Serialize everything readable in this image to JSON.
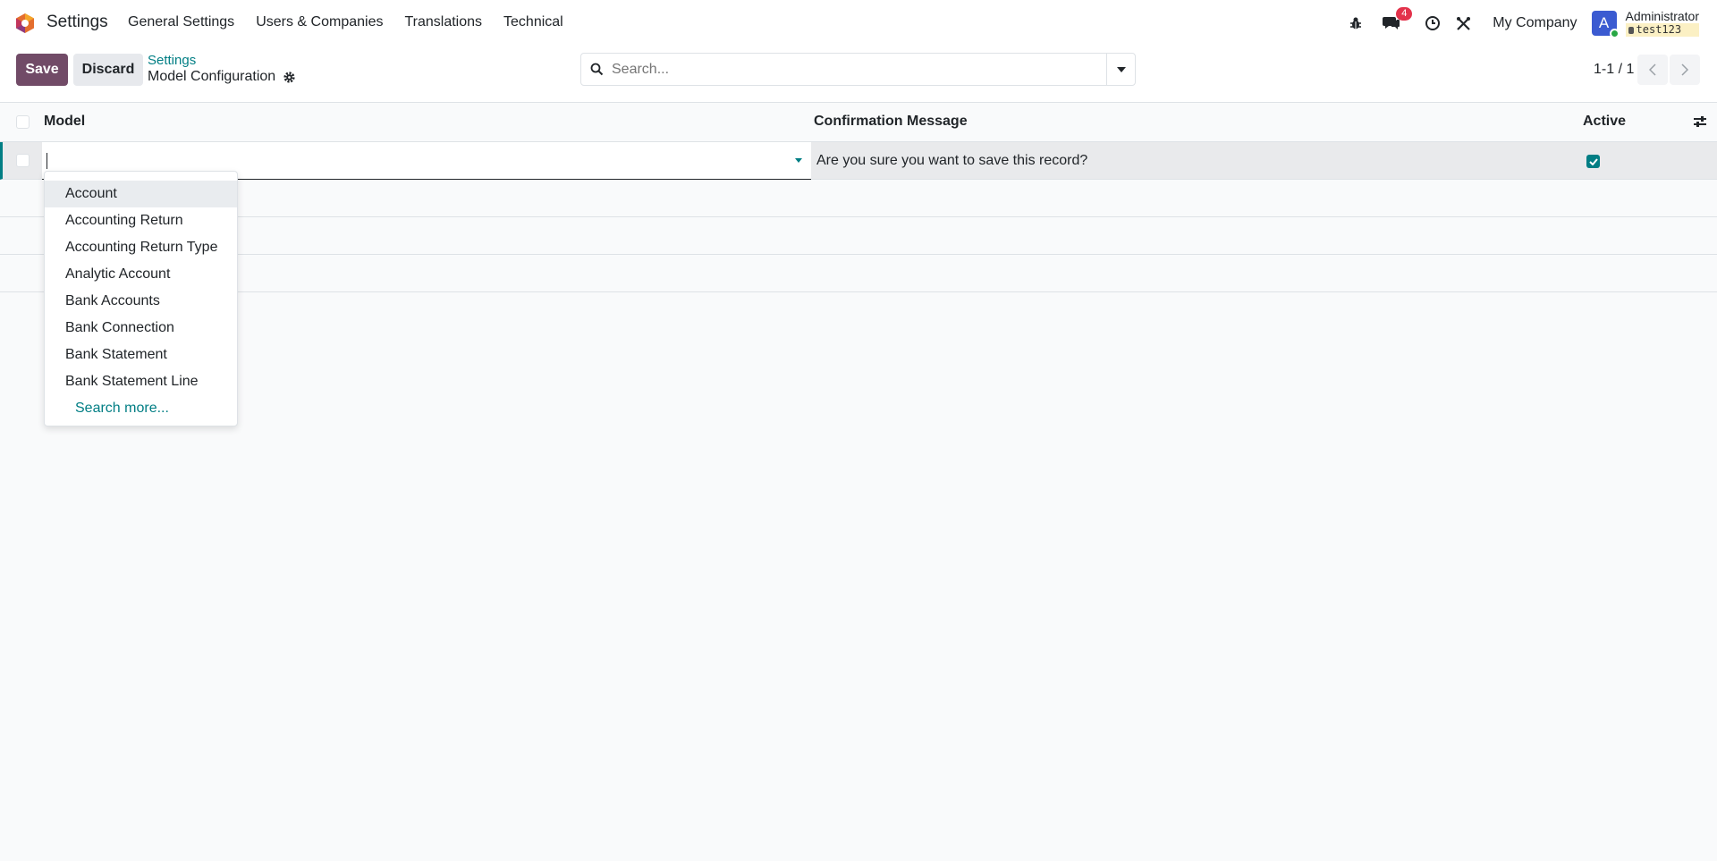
{
  "navbar": {
    "app_title": "Settings",
    "menu": [
      "General Settings",
      "Users & Companies",
      "Translations",
      "Technical"
    ],
    "messages_badge": "4",
    "company": "My Company",
    "avatar_letter": "A",
    "user_name": "Administrator",
    "db_name": "test123"
  },
  "control_panel": {
    "save_label": "Save",
    "discard_label": "Discard",
    "breadcrumb_parent": "Settings",
    "breadcrumb_current": "Model Configuration",
    "search_placeholder": "Search...",
    "pager": "1-1 / 1"
  },
  "list": {
    "columns": {
      "model": "Model",
      "confirmation_message": "Confirmation Message",
      "active": "Active"
    },
    "rows": [
      {
        "model": "",
        "confirmation_message": "Are you sure you want to save this record?",
        "active": true
      }
    ]
  },
  "dropdown": {
    "items": [
      "Account",
      "Accounting Return",
      "Accounting Return Type",
      "Analytic Account",
      "Bank Accounts",
      "Bank Connection",
      "Bank Statement",
      "Bank Statement Line"
    ],
    "search_more": "Search more..."
  },
  "colors": {
    "brand": "#714b67",
    "accent": "#017e84",
    "badge": "#e3324b"
  }
}
